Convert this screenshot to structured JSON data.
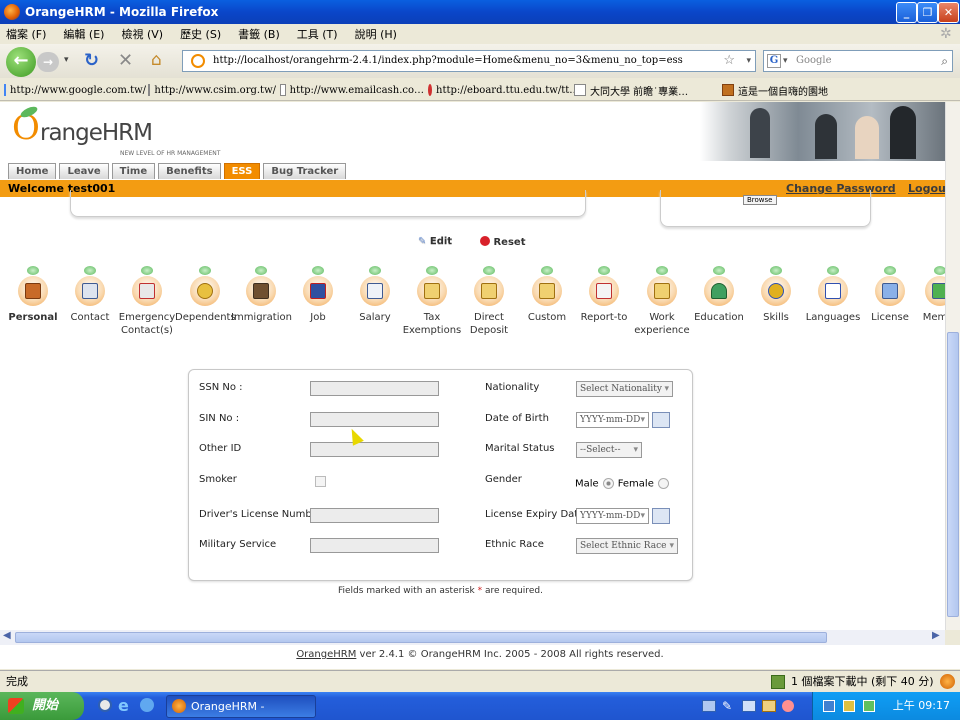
{
  "window": {
    "title": "OrangeHRM - Mozilla Firefox"
  },
  "menu": [
    "檔案 (F)",
    "編輯 (E)",
    "檢視 (V)",
    "歷史 (S)",
    "書籤 (B)",
    "工具 (T)",
    "說明 (H)"
  ],
  "url": "http://localhost/orangehrm-2.4.1/index.php?module=Home&menu_no=3&menu_no_top=ess",
  "search_placeholder": "Google",
  "bookmarks": [
    "http://www.google.com.tw/",
    "http://www.csim.org.tw/",
    "http://www.emailcash.co…",
    "http://eboard.ttu.edu.tw/tt…",
    "大同大學 前瞻˙專業…",
    "這是一個自嗨的園地"
  ],
  "app": {
    "logo_text": "rangeHRM",
    "tagline": "NEW LEVEL OF HR MANAGEMENT",
    "tabs": [
      "Home",
      "Leave",
      "Time",
      "Benefits",
      "ESS",
      "Bug Tracker"
    ],
    "active_tab": "ESS",
    "welcome": "Welcome test001",
    "change_password": "Change Password",
    "logout": "Logout",
    "browse_label": "Browse",
    "edit_label": "Edit",
    "reset_label": "Reset"
  },
  "icons": [
    {
      "label": "Personal",
      "name": "personal-icon"
    },
    {
      "label": "Contact",
      "name": "contact-icon"
    },
    {
      "label": "Emergency Contact(s)",
      "name": "emergency-contacts-icon"
    },
    {
      "label": "Dependents",
      "name": "dependents-icon"
    },
    {
      "label": "Immigration",
      "name": "immigration-icon"
    },
    {
      "label": "Job",
      "name": "job-icon"
    },
    {
      "label": "Salary",
      "name": "salary-icon"
    },
    {
      "label": "Tax Exemptions",
      "name": "tax-exemptions-icon"
    },
    {
      "label": "Direct Deposit",
      "name": "direct-deposit-icon"
    },
    {
      "label": "Custom",
      "name": "custom-icon"
    },
    {
      "label": "Report-to",
      "name": "report-to-icon"
    },
    {
      "label": "Work experience",
      "name": "work-experience-icon"
    },
    {
      "label": "Education",
      "name": "education-icon"
    },
    {
      "label": "Skills",
      "name": "skills-icon"
    },
    {
      "label": "Languages",
      "name": "languages-icon"
    },
    {
      "label": "License",
      "name": "license-icon"
    },
    {
      "label": "Mem",
      "name": "membership-icon"
    }
  ],
  "form": {
    "ssn": "SSN No :",
    "sin": "SIN No :",
    "other_id": "Other ID",
    "smoker": "Smoker",
    "drivers_license": "Driver's License Number",
    "military": "Military Service",
    "nationality": "Nationality",
    "nationality_value": "Select Nationality",
    "dob": "Date of Birth",
    "date_placeholder": "YYYY-mm-DD",
    "marital": "Marital Status",
    "marital_value": "--Select--",
    "gender": "Gender",
    "male": "Male",
    "female": "Female",
    "license_expiry": "License Expiry Date",
    "ethnic": "Ethnic Race",
    "ethnic_value": "Select Ethnic Race",
    "required_note_pre": "Fields marked with an asterisk ",
    "required_star": "*",
    "required_note_post": " are required."
  },
  "footer": {
    "link": "OrangeHRM",
    "text": " ver 2.4.1 © OrangeHRM Inc. 2005 - 2008 All rights reserved."
  },
  "status": {
    "left": "完成",
    "right": "1 個檔案下載中 (剩下 40 分)"
  },
  "taskbar": {
    "start": "開始",
    "item": "OrangeHRM - Mozilla...",
    "clock": "上午 09:17"
  }
}
